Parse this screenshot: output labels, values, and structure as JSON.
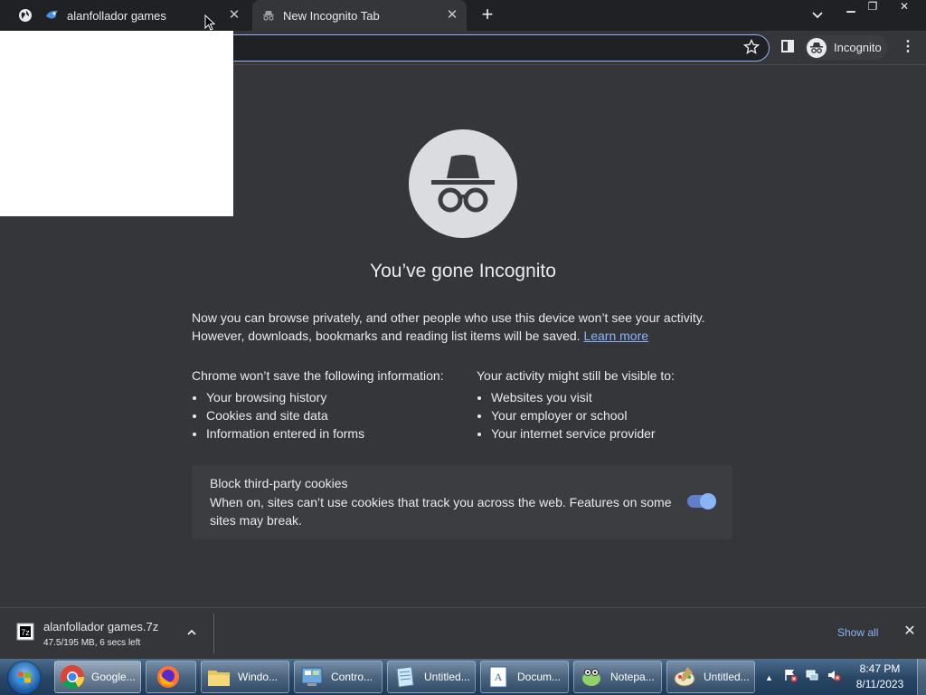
{
  "browser": {
    "tabs": [
      {
        "title": "alanfollador games",
        "icon": "site-favicon-icon"
      },
      {
        "title": "New Incognito Tab",
        "icon": "incognito-icon"
      }
    ],
    "profile_label": "Incognito"
  },
  "incognito_page": {
    "heading": "You’ve gone Incognito",
    "intro_line1": "Now you can browse privately, and other people who use this device won’t see your activity.",
    "intro_line2": "However, downloads, bookmarks and reading list items will be saved.",
    "learn_more": "Learn more",
    "left_heading": "Chrome won’t save the following information:",
    "left_items": [
      "Your browsing history",
      "Cookies and site data",
      "Information entered in forms"
    ],
    "right_heading_prefix": "Your activity",
    "right_heading_emph": "might",
    "right_heading_suffix": "still be visible to:",
    "right_items": [
      "Websites you visit",
      "Your employer or school",
      "Your internet service provider"
    ],
    "cookies": {
      "title": "Block third-party cookies",
      "description": "When on, sites can’t use cookies that track you across the web. Features on some sites may break.",
      "enabled": true
    }
  },
  "download": {
    "filename": "alanfollador games.7z",
    "status": "47.5/195 MB, 6 secs left",
    "show_all": "Show all"
  },
  "taskbar": {
    "items": [
      {
        "label": "Google...",
        "icon": "chrome-icon"
      },
      {
        "label": "",
        "icon": "firefox-icon"
      },
      {
        "label": "Windo...",
        "icon": "folder-icon"
      },
      {
        "label": "Contro...",
        "icon": "control-panel-icon"
      },
      {
        "label": "Untitled...",
        "icon": "notepad-doc-icon"
      },
      {
        "label": "Docum...",
        "icon": "wordpad-icon"
      },
      {
        "label": "Notepa...",
        "icon": "notepadpp-icon"
      },
      {
        "label": "Untitled...",
        "icon": "paint-icon"
      }
    ],
    "time": "8:47 PM",
    "date": "8/11/2023"
  },
  "colors": {
    "page_bg": "#35363a",
    "accent": "#8ab4f8",
    "tabstrip_bg": "#202124"
  }
}
